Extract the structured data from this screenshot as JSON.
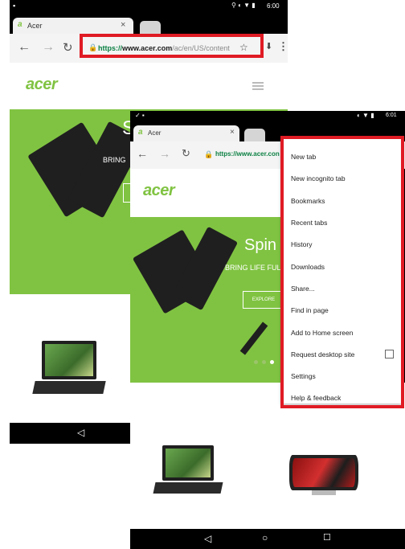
{
  "back": {
    "status_time": "6:00",
    "tab_title": "Acer",
    "tab_close": "×",
    "url_https": "https://",
    "url_host": "www.acer.com",
    "url_path": "/ac/en/US/content",
    "brand": "acer",
    "hero_text": "BRING",
    "hero_text_big": "S"
  },
  "front": {
    "status_time": "6:01",
    "tab_title": "Acer",
    "tab_close": "×",
    "url": "https://www.acer.con",
    "brand": "acer",
    "hero_title": "Spin",
    "hero_subtitle": "BRING LIFE FULI",
    "explore_label": "EXPLORE",
    "menu": [
      {
        "label": "New tab"
      },
      {
        "label": "New incognito tab"
      },
      {
        "label": "Bookmarks"
      },
      {
        "label": "Recent tabs"
      },
      {
        "label": "History"
      },
      {
        "label": "Downloads"
      },
      {
        "label": "Share..."
      },
      {
        "label": "Find in page"
      },
      {
        "label": "Add to Home screen"
      },
      {
        "label": "Request desktop site"
      },
      {
        "label": "Settings"
      },
      {
        "label": "Help & feedback"
      }
    ]
  },
  "icons": {
    "back": "back-arrow-icon",
    "forward": "forward-arrow-icon",
    "reload": "reload-icon",
    "star": "star-icon",
    "overflow": "overflow-menu-icon"
  },
  "colors": {
    "highlight": "#e01b24",
    "brand_green": "#80c342",
    "https_green": "#0b8043"
  }
}
